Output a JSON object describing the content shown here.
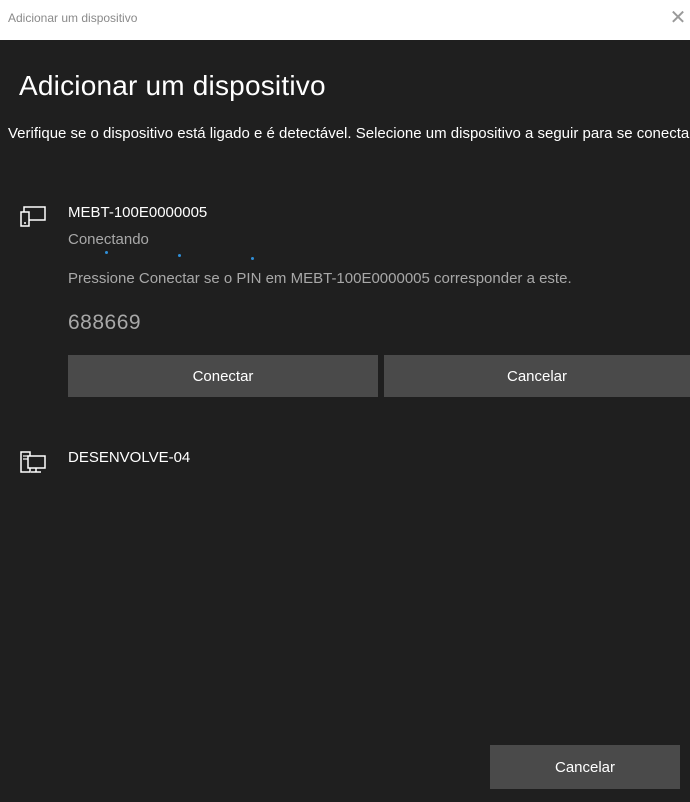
{
  "window": {
    "title": "Adicionar um dispositivo",
    "close_glyph": "✕"
  },
  "main": {
    "heading": "Adicionar um dispositivo",
    "description": "Verifique se o dispositivo está ligado e é detectável. Selecione um dispositivo a seguir para se conectar."
  },
  "devices": [
    {
      "name": "MEBT-100E0000005",
      "icon": "tablet-device-icon",
      "status": "Conectando",
      "pin_instruction": "Pressione Conectar se o PIN em MEBT-100E0000005 corresponder a este.",
      "pin": "688669",
      "connect_label": "Conectar",
      "cancel_label": "Cancelar"
    },
    {
      "name": "DESENVOLVE-04",
      "icon": "desktop-computer-icon"
    }
  ],
  "footer": {
    "cancel_label": "Cancelar"
  },
  "colors": {
    "background": "#1f1f1f",
    "button": "#4a4a4a",
    "secondary_text": "#a8a8a8",
    "progress_accent": "#2f8fd8"
  }
}
